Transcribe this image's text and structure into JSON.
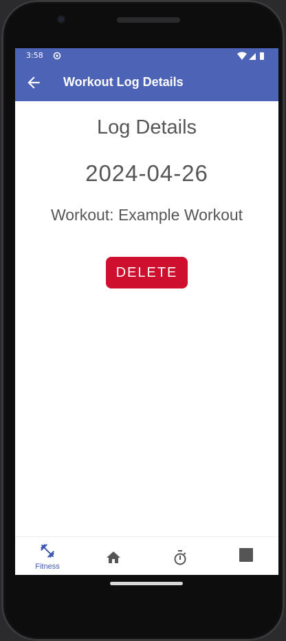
{
  "status_bar": {
    "time": "3:58"
  },
  "app_bar": {
    "title": "Workout Log Details",
    "back_icon": "arrow-back-icon"
  },
  "log": {
    "heading": "Log Details",
    "date": "2024-04-26",
    "workout": "Workout: Example Workout"
  },
  "actions": {
    "delete_label": "DELETE",
    "delete_color": "#cf0f2e"
  },
  "bottom_nav": {
    "items": [
      {
        "icon": "fitness-dumbbell-icon",
        "label": "Fitness",
        "active": true
      },
      {
        "icon": "home-icon",
        "label": "",
        "active": false
      },
      {
        "icon": "timer-icon",
        "label": "",
        "active": false
      },
      {
        "icon": "square-icon",
        "label": "",
        "active": false
      }
    ]
  },
  "colors": {
    "primary": "#4c63b6",
    "active_nav": "#3d57b0",
    "text_gray": "#555555"
  }
}
